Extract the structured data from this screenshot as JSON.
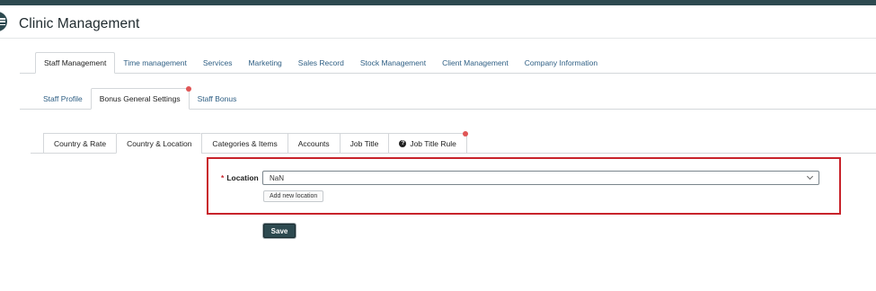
{
  "app": {
    "title": "Clinic Management"
  },
  "main_tabs": [
    {
      "label": "Staff Management",
      "active": true
    },
    {
      "label": "Time management",
      "active": false
    },
    {
      "label": "Services",
      "active": false
    },
    {
      "label": "Marketing",
      "active": false
    },
    {
      "label": "Sales Record",
      "active": false
    },
    {
      "label": "Stock Management",
      "active": false
    },
    {
      "label": "Client Management",
      "active": false
    },
    {
      "label": "Company Information",
      "active": false
    }
  ],
  "sub_tabs": [
    {
      "label": "Staff Profile",
      "active": false
    },
    {
      "label": "Bonus General Settings",
      "active": true,
      "notification": true
    },
    {
      "label": "Staff Bonus",
      "active": false
    }
  ],
  "bonus_tabs": [
    {
      "label": "Country & Rate",
      "active": false
    },
    {
      "label": "Country & Location",
      "active": true
    },
    {
      "label": "Categories & Items",
      "active": false
    },
    {
      "label": "Accounts",
      "active": false
    },
    {
      "label": "Job Title",
      "active": false
    },
    {
      "label": "Job Title Rule",
      "active": false,
      "icon": "question-circle-icon",
      "notification": true
    }
  ],
  "form": {
    "location_label": "Location",
    "required_marker": "*",
    "location_value": "NaN",
    "add_location_label": "Add new location",
    "save_label": "Save"
  },
  "colors": {
    "brand": "#2d4a50",
    "link": "#2f5f84",
    "highlight": "#c8232b",
    "notification": "#e05555"
  }
}
